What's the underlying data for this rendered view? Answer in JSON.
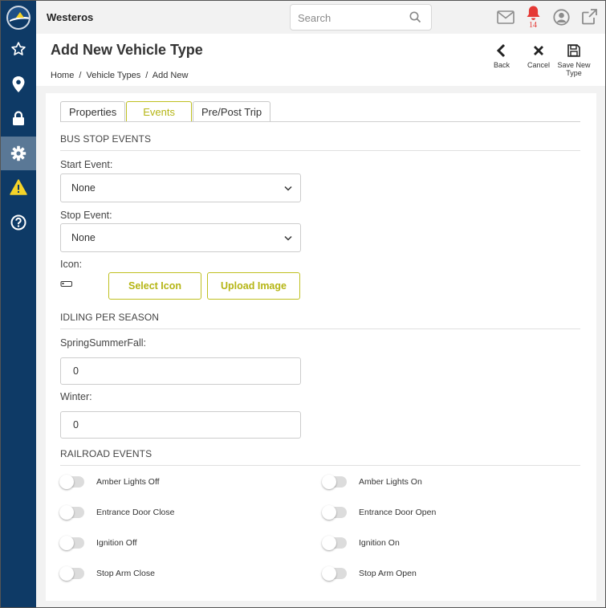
{
  "app": {
    "brand": "Westeros"
  },
  "search": {
    "placeholder": "Search"
  },
  "notifications": {
    "count": "14",
    "color": "#e53935"
  },
  "sidebar": {
    "items": [
      {
        "icon": "star-icon"
      },
      {
        "icon": "location-pin-icon"
      },
      {
        "icon": "lock-icon"
      },
      {
        "icon": "gear-icon",
        "active": true
      },
      {
        "icon": "warning-icon",
        "color": "#f5d328"
      },
      {
        "icon": "help-icon"
      }
    ]
  },
  "header": {
    "title": "Add New Vehicle Type",
    "breadcrumb": [
      "Home",
      "/",
      "Vehicle Types",
      "/",
      "Add New"
    ],
    "back_label": "Back",
    "cancel_label": "Cancel",
    "save_label": "Save New Type"
  },
  "tabs": [
    {
      "label": "Properties",
      "active": false
    },
    {
      "label": "Events",
      "active": true
    },
    {
      "label": "Pre/Post Trip",
      "active": false
    }
  ],
  "bus_stop": {
    "title": "BUS STOP EVENTS",
    "start_label": "Start Event:",
    "start_value": "None",
    "stop_label": "Stop Event:",
    "stop_value": "None",
    "icon_label": "Icon:",
    "select_icon": "Select Icon",
    "upload_image": "Upload Image"
  },
  "idling": {
    "title": "IDLING PER SEASON",
    "ssf_label": "SpringSummerFall:",
    "ssf_value": "0",
    "winter_label": "Winter:",
    "winter_value": "0"
  },
  "railroad": {
    "title": "RAILROAD EVENTS",
    "toggles": [
      {
        "label": "Amber Lights Off",
        "on": false
      },
      {
        "label": "Amber Lights On",
        "on": false
      },
      {
        "label": "Entrance Door Close",
        "on": false
      },
      {
        "label": "Entrance Door Open",
        "on": false
      },
      {
        "label": "Ignition Off",
        "on": false
      },
      {
        "label": "Ignition On",
        "on": false
      },
      {
        "label": "Stop Arm Close",
        "on": false
      },
      {
        "label": "Stop Arm Open",
        "on": false
      }
    ]
  },
  "colors": {
    "sidebar": "#0e3a66",
    "accent": "#bfc020",
    "sidebar_active": "#5a7896"
  }
}
